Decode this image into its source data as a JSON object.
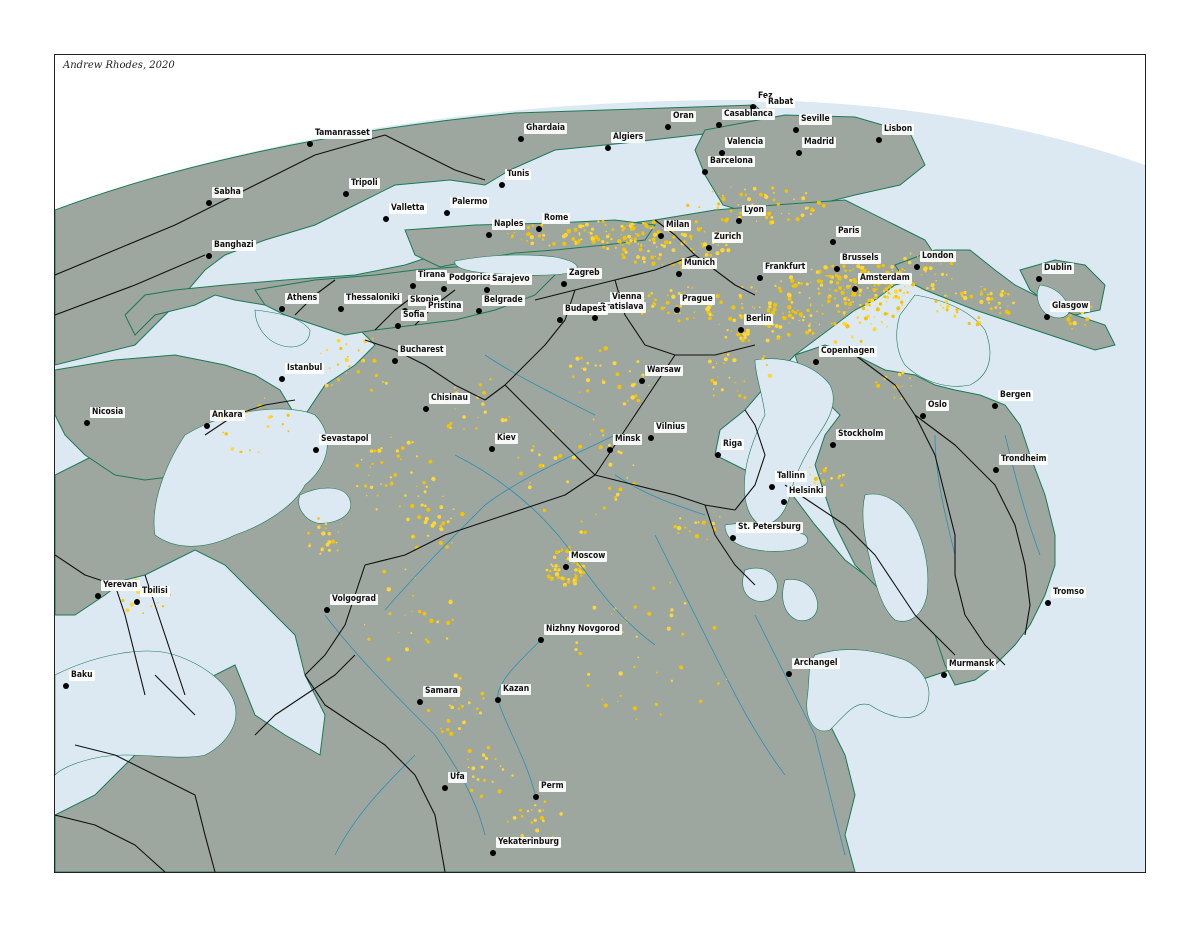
{
  "map": {
    "credit": "Andrew Rhodes, 2020",
    "colors": {
      "ocean": "#dce9f3",
      "land": "#9da79f",
      "land_light": "#b3bbb5",
      "urban": "#f5c400",
      "urban_bright": "#ffd633",
      "coast": "#1a7a55",
      "rivers": "#2c8fb3",
      "borders": "#111111",
      "label_bg": "#ffffff"
    },
    "cities": [
      {
        "name": "Fez"
      },
      {
        "name": "Rabat"
      },
      {
        "name": "Oran"
      },
      {
        "name": "Casablanca"
      },
      {
        "name": "Seville"
      },
      {
        "name": "Lisbon"
      },
      {
        "name": "Tamanrasset"
      },
      {
        "name": "Ghardaia"
      },
      {
        "name": "Algiers"
      },
      {
        "name": "Valencia"
      },
      {
        "name": "Madrid"
      },
      {
        "name": "Barcelona"
      },
      {
        "name": "Tunis"
      },
      {
        "name": "Sabha"
      },
      {
        "name": "Tripoli"
      },
      {
        "name": "Valletta"
      },
      {
        "name": "Palermo"
      },
      {
        "name": "Lyon"
      },
      {
        "name": "Naples"
      },
      {
        "name": "Rome"
      },
      {
        "name": "Milan"
      },
      {
        "name": "Paris"
      },
      {
        "name": "Zurich"
      },
      {
        "name": "Banghazi"
      },
      {
        "name": "London"
      },
      {
        "name": "Munich"
      },
      {
        "name": "Frankfurt"
      },
      {
        "name": "Brussels"
      },
      {
        "name": "Dublin"
      },
      {
        "name": "Amsterdam"
      },
      {
        "name": "Tirana"
      },
      {
        "name": "Podgorica"
      },
      {
        "name": "Sarajevo"
      },
      {
        "name": "Zagreb"
      },
      {
        "name": "Athens"
      },
      {
        "name": "Thessaloniki"
      },
      {
        "name": "Skopje"
      },
      {
        "name": "Pristina"
      },
      {
        "name": "Belgrade"
      },
      {
        "name": "Sofia"
      },
      {
        "name": "Vienna"
      },
      {
        "name": "Bratislava"
      },
      {
        "name": "Budapest"
      },
      {
        "name": "Prague"
      },
      {
        "name": "Glasgow"
      },
      {
        "name": "Berlin"
      },
      {
        "name": "Bucharest"
      },
      {
        "name": "Copenhagen"
      },
      {
        "name": "Istanbul"
      },
      {
        "name": "Warsaw"
      },
      {
        "name": "Chisinau"
      },
      {
        "name": "Bergen"
      },
      {
        "name": "Oslo"
      },
      {
        "name": "Nicosia"
      },
      {
        "name": "Ankara"
      },
      {
        "name": "Vilnius"
      },
      {
        "name": "Sevastapol"
      },
      {
        "name": "Kiev"
      },
      {
        "name": "Minsk"
      },
      {
        "name": "Riga"
      },
      {
        "name": "Stockholm"
      },
      {
        "name": "Trondheim"
      },
      {
        "name": "Tallinn"
      },
      {
        "name": "Helsinki"
      },
      {
        "name": "St. Petersburg"
      },
      {
        "name": "Moscow"
      },
      {
        "name": "Yerevan"
      },
      {
        "name": "Tbilisi"
      },
      {
        "name": "Volgograd"
      },
      {
        "name": "Tromso"
      },
      {
        "name": "Nizhny Novgorod"
      },
      {
        "name": "Archangel"
      },
      {
        "name": "Murmansk"
      },
      {
        "name": "Baku"
      },
      {
        "name": "Samara"
      },
      {
        "name": "Kazan"
      },
      {
        "name": "Ufa"
      },
      {
        "name": "Perm"
      },
      {
        "name": "Yekaterinburg"
      }
    ]
  }
}
